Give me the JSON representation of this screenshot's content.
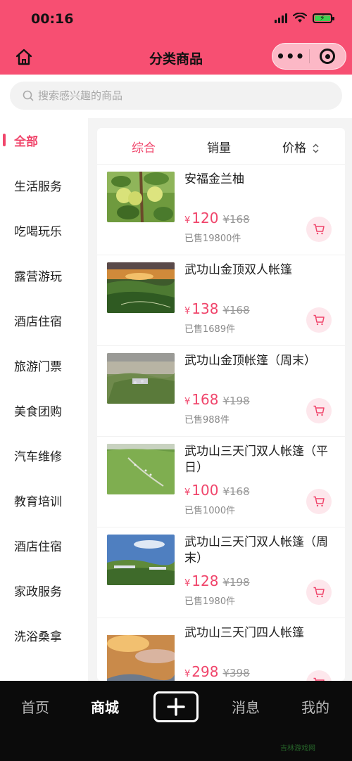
{
  "status_bar": {
    "time": "00:16",
    "icons": [
      "signal-icon",
      "wifi-icon",
      "battery-charging-icon"
    ]
  },
  "nav_bar": {
    "title": "分类商品",
    "left_icon": "home-icon",
    "capsule": {
      "more_label": "•••",
      "icons": [
        "more-dots-icon",
        "close-target-icon"
      ]
    }
  },
  "search": {
    "placeholder": "搜索感兴趣的商品",
    "icon": "search-icon"
  },
  "sidebar": {
    "items": [
      {
        "label": "全部",
        "active": true
      },
      {
        "label": "生活服务"
      },
      {
        "label": "吃喝玩乐"
      },
      {
        "label": "露营游玩"
      },
      {
        "label": "酒店住宿"
      },
      {
        "label": "旅游门票"
      },
      {
        "label": "美食团购"
      },
      {
        "label": "汽车维修"
      },
      {
        "label": "教育培训"
      },
      {
        "label": "酒店住宿"
      },
      {
        "label": "家政服务"
      },
      {
        "label": "洗浴桑拿"
      }
    ]
  },
  "sort_bar": {
    "tabs": [
      {
        "label": "综合",
        "active": true
      },
      {
        "label": "销量"
      },
      {
        "label": "价格"
      }
    ]
  },
  "products": [
    {
      "title": "安福金兰柚",
      "currency": "¥",
      "price": "120",
      "original_price": "¥168",
      "sold": "已售19800件",
      "image": "pomelo-tree"
    },
    {
      "title": "武功山金顶双人帐篷",
      "currency": "¥",
      "price": "138",
      "original_price": "¥168",
      "sold": "已售1689件",
      "image": "mountain-sunset"
    },
    {
      "title": "武功山金顶帐篷（周末）",
      "currency": "¥",
      "price": "168",
      "original_price": "¥198",
      "sold": "已售988件",
      "image": "mountain-tents"
    },
    {
      "title": "武功山三天门双人帐篷（平日）",
      "currency": "¥",
      "price": "100",
      "original_price": "¥168",
      "sold": "已售1000件",
      "image": "mountain-aerial"
    },
    {
      "title": "武功山三天门双人帐篷（周末）",
      "currency": "¥",
      "price": "128",
      "original_price": "¥198",
      "sold": "已售1980件",
      "image": "mountain-blue-sky"
    },
    {
      "title": "武功山三天门四人帐篷",
      "currency": "¥",
      "price": "298",
      "original_price": "¥398",
      "sold": "",
      "image": "mountain-clouds"
    }
  ],
  "tabbar": {
    "items": [
      {
        "label": "首页"
      },
      {
        "label": "商城",
        "active": true
      },
      {
        "label": "消息"
      },
      {
        "label": "我的"
      }
    ],
    "center_icon": "plus-icon"
  },
  "watermark": "吉林游戏网",
  "colors": {
    "brand": "#f74f72",
    "accent": "#f0456b",
    "tabbar": "#0b0b0b"
  }
}
